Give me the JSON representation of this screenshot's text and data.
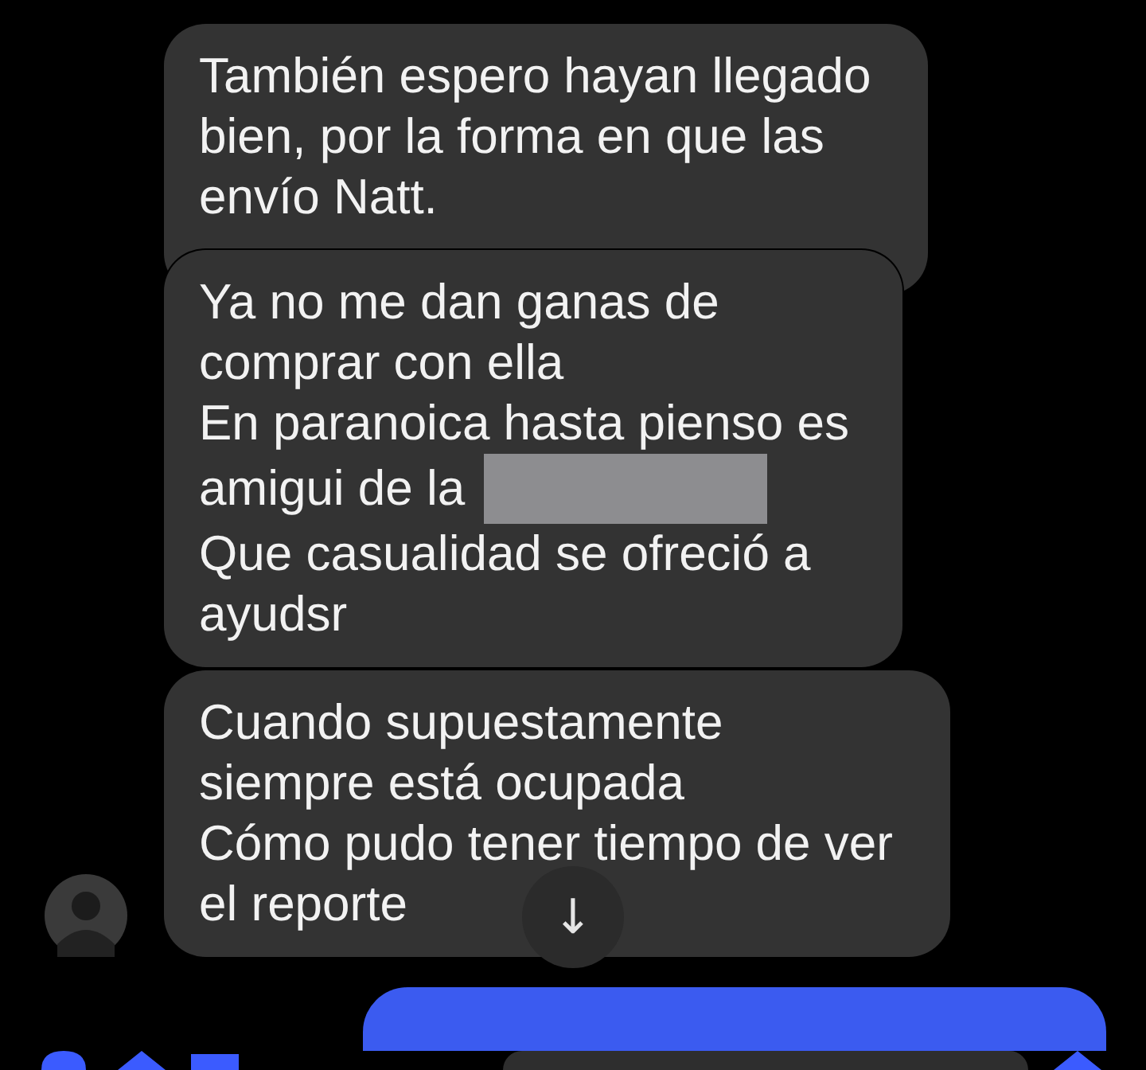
{
  "messages": [
    {
      "text": "También espero hayan llegado bien, por la forma en que las envío Natt.",
      "avatar": false
    },
    {
      "lines": [
        {
          "text": "Ya no me dan ganas de",
          "redacted": false
        },
        {
          "text": "comprar con ella",
          "redacted": false
        },
        {
          "text": "En paranoica hasta pienso es",
          "redacted": false
        },
        {
          "text": "amigui de la",
          "redacted": true
        },
        {
          "text": "Que casualidad se ofreció a",
          "redacted": false
        },
        {
          "text": "ayudsr",
          "redacted": false
        }
      ],
      "avatar": false
    },
    {
      "lines": [
        {
          "text": "Cuando supuestamente",
          "redacted": false
        },
        {
          "text": "siempre está ocupada",
          "redacted": false
        },
        {
          "text": "Cómo pudo tener tiempo de ver",
          "redacted": false
        },
        {
          "text": "el reporte",
          "redacted": false
        }
      ],
      "avatar": true
    }
  ],
  "scroll_down_button": {
    "icon": "↓"
  }
}
